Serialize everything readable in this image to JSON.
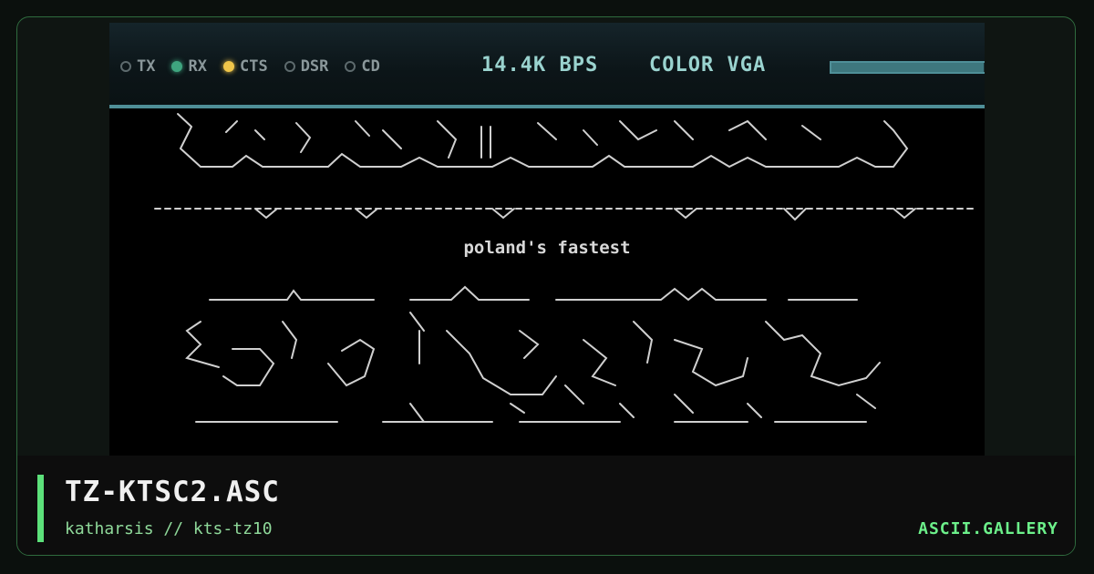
{
  "status_bar": {
    "indicators": [
      {
        "label": "TX",
        "state": "off"
      },
      {
        "label": "RX",
        "state": "green"
      },
      {
        "label": "CTS",
        "state": "yellow"
      },
      {
        "label": "DSR",
        "state": "off"
      },
      {
        "label": "CD",
        "state": "off"
      }
    ],
    "speed": "14.4K BPS",
    "video_mode": "COLOR VGA",
    "progress": 0.95
  },
  "terminal": {
    "tagline": "poland's fastest"
  },
  "info": {
    "title": "TZ-KTSC2.ASC",
    "subtitle": "katharsis // kts-tz10",
    "brand": "ASCII.GALLERY"
  },
  "colors": {
    "accent": "#5ce07a",
    "led_green": "#3fa57f",
    "led_yellow": "#f0c64a",
    "status_text": "#9ad3cf"
  }
}
